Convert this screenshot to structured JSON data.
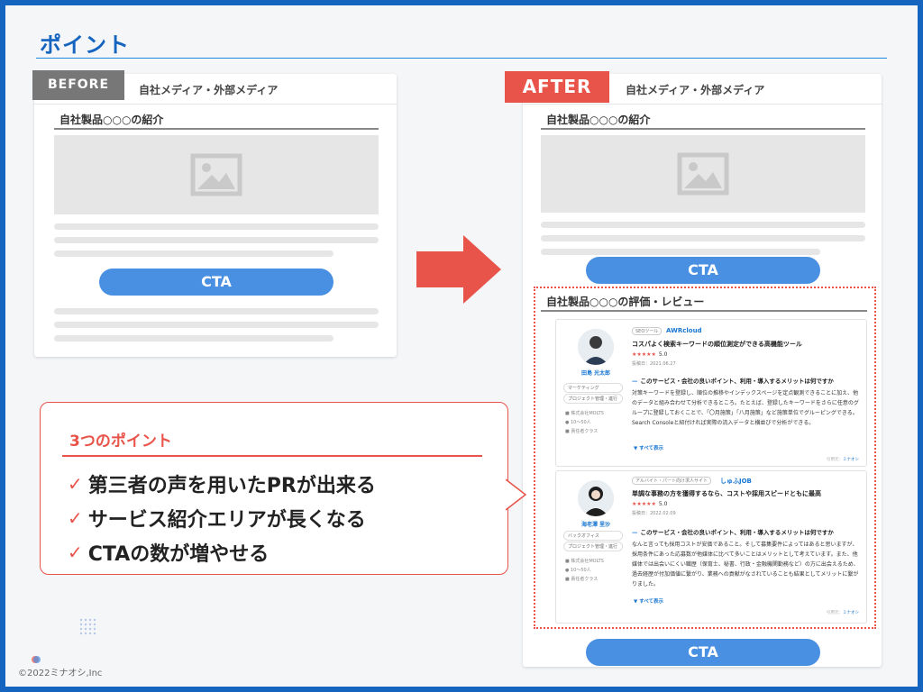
{
  "page": {
    "title": "ポイント",
    "copyright": "©2022ミナオシ,Inc"
  },
  "colors": {
    "brand_blue": "#1565c0",
    "accent_red": "#e8534a",
    "cta_blue": "#4a90e2"
  },
  "before": {
    "badge": "BEFORE",
    "header": "自社メディア・外部メディア",
    "section_title": "自社製品○○○の紹介",
    "cta": "CTA"
  },
  "after": {
    "badge": "AFTER",
    "header": "自社メディア・外部メディア",
    "section_title": "自社製品○○○の紹介",
    "cta_top": "CTA",
    "review_section_title": "自社製品○○○の評価・レビュー",
    "cta_bottom": "CTA",
    "reviews": [
      {
        "name": "田島 光太郎",
        "tags": [
          "マーケティング",
          "プロジェクト管理・進行"
        ],
        "company": "株式会社MOLTS",
        "size": "10〜50人",
        "role": "責任者クラス",
        "category": "SEOツール",
        "service": "AWRcloud",
        "headline": "コスパよく検索キーワードの順位測定ができる高機能ツール",
        "stars": "★★★★★",
        "rating": "5.0",
        "date": "投稿日：2021.06.27",
        "question": "このサービス・会社の良いポイント、利用・導入するメリットは何ですか",
        "body": "対策キーワードを登録し、順位の推移やインデックスページを定点観測できることに加え、他のデータと組み合わせて分析できるところ。たとえば、登録したキーワードをさらに任意のグループに登録しておくことで、「〇月施策」「八月施策」など施策単位でグルーピングできる。Search Consoleと紐付ければ実際の流入データと横並びで分析ができる。",
        "more": "▼ すべて表示",
        "source_label": "引用元：",
        "source": "ミナオシ"
      },
      {
        "name": "海老澤 里沙",
        "tags": [
          "バックオフィス",
          "プロジェクト管理・進行"
        ],
        "company": "株式会社MOLTS",
        "size": "10〜50人",
        "role": "責任者クラス",
        "category": "アルバイト・パート向け求人サイト",
        "service": "しゅふJOB",
        "headline": "単調な事務の方を獲得するなら、コストや採用スピードともに最高",
        "stars": "★★★★★",
        "rating": "5.0",
        "date": "投稿日：2022.02.09",
        "question": "このサービス・会社の良いポイント、利用・導入するメリットは何ですか",
        "body": "なんと言っても採用コストが安価であること。そして募集要件によってはあると思いますが、採用条件にあった応募数が他媒体に比べて多いことはメリットとして考えています。また、他媒体では出会いにくい職歴（保育士、秘書、行政・金融機関勤務など）の方に出会えるため、過去経歴が付加価値に繋がり、業務への貢献がなされていることも結果としてメリットに繋がりました。",
        "more": "▼ すべて表示",
        "source_label": "引用元：",
        "source": "ミナオシ"
      }
    ]
  },
  "points": {
    "heading": "3つのポイント",
    "check_icon": "✓",
    "items": [
      "第三者の声を用いたPRが出来る",
      "サービス紹介エリアが長くなる",
      "CTAの数が増やせる"
    ]
  }
}
